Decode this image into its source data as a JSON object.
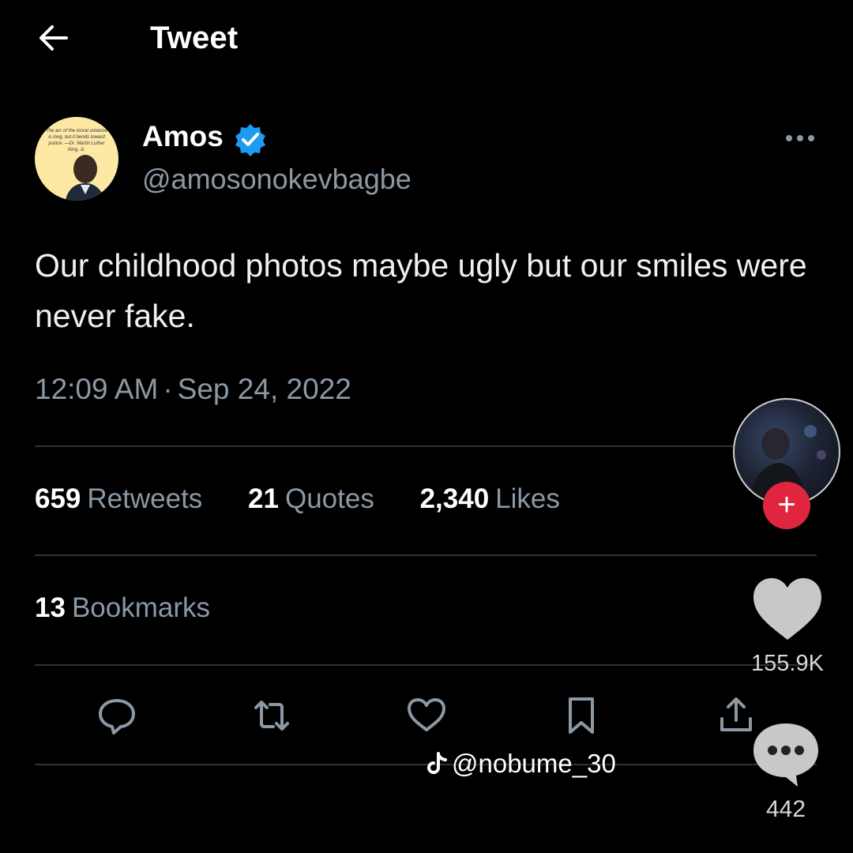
{
  "header": {
    "title": "Tweet",
    "back_icon": "arrow-left-icon"
  },
  "author": {
    "name": "Amos",
    "handle": "@amosonokevbagbe",
    "verified": true,
    "avatar_quote": "The arc of the moral universe is long, but it bends toward justice. —Dr. Martin Luther King, Jr."
  },
  "tweet": {
    "text": "Our childhood photos maybe ugly but our smiles were never fake.",
    "time": "12:09 AM",
    "separator": "·",
    "date": "Sep 24, 2022"
  },
  "stats": {
    "retweets_count": "659",
    "retweets_label": "Retweets",
    "quotes_count": "21",
    "quotes_label": "Quotes",
    "likes_count": "2,340",
    "likes_label": "Likes",
    "bookmarks_count": "13",
    "bookmarks_label": "Bookmarks"
  },
  "actions": [
    "reply-icon",
    "retweet-icon",
    "like-icon",
    "bookmark-icon",
    "share-icon"
  ],
  "overlay": {
    "like_count": "155.9K",
    "comment_count": "442",
    "watermark": "@nobume_30",
    "follow_symbol": "+"
  },
  "colors": {
    "background": "#000000",
    "text_primary": "#ffffff",
    "text_secondary": "#8b98a5",
    "divider": "#2f3336",
    "verified_blue": "#1d9bf0",
    "follow_red": "#e0253f"
  }
}
